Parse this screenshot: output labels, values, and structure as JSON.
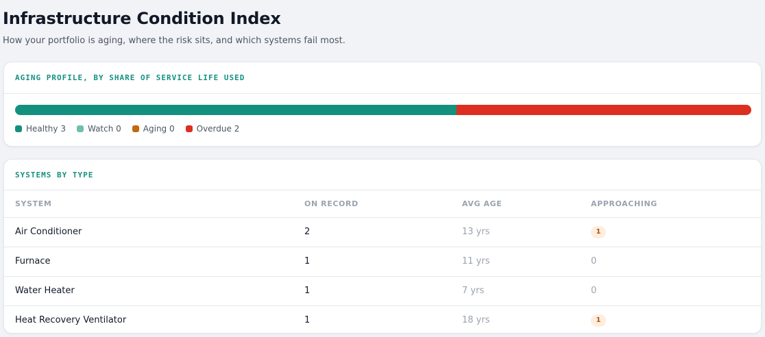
{
  "header": {
    "title": "Infrastructure Condition Index",
    "subtitle": "How your portfolio is aging, where the risk sits, and which systems fail most."
  },
  "aging": {
    "label": "AGING PROFILE, BY SHARE OF SERVICE LIFE USED",
    "segments": [
      {
        "name": "Healthy",
        "count": 3,
        "color": "#14907f",
        "legend": "Healthy 3"
      },
      {
        "name": "Watch",
        "count": 0,
        "color": "#6fbfae",
        "legend": "Watch 0"
      },
      {
        "name": "Aging",
        "count": 0,
        "color": "#c2690f",
        "legend": "Aging 0"
      },
      {
        "name": "Overdue",
        "count": 2,
        "color": "#dc2f22",
        "legend": "Overdue 2"
      }
    ]
  },
  "systems": {
    "label": "SYSTEMS BY TYPE",
    "columns": [
      "SYSTEM",
      "ON RECORD",
      "AVG AGE",
      "APPROACHING"
    ],
    "rows": [
      {
        "system": "Air Conditioner",
        "on_record": "2",
        "avg_age": "13 yrs",
        "approaching": "1"
      },
      {
        "system": "Furnace",
        "on_record": "1",
        "avg_age": "11 yrs",
        "approaching": "0"
      },
      {
        "system": "Water Heater",
        "on_record": "1",
        "avg_age": "7 yrs",
        "approaching": "0"
      },
      {
        "system": "Heat Recovery Ventilator",
        "on_record": "1",
        "avg_age": "18 yrs",
        "approaching": "1"
      }
    ]
  }
}
